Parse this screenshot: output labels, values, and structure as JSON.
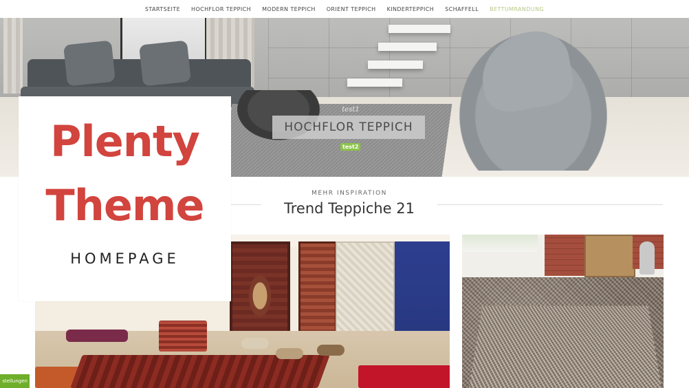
{
  "nav": {
    "items": [
      {
        "label": "STARTSEITE",
        "active": false
      },
      {
        "label": "HOCHFLOR TEPPICH",
        "active": false
      },
      {
        "label": "MODERN TEPPICH",
        "active": false
      },
      {
        "label": "ORIENT TEPPICH",
        "active": false
      },
      {
        "label": "KINDERTEPPICH",
        "active": false
      },
      {
        "label": "SCHAFFELL",
        "active": false
      },
      {
        "label": "BETTUMRANDUNG",
        "active": true
      }
    ]
  },
  "hero": {
    "subtitle": "test1",
    "title": "HOCHFLOR TEPPICH",
    "badge": "test2"
  },
  "overlay": {
    "line1": "Plenty",
    "line2": "Theme",
    "sub": "HOMEPAGE"
  },
  "section": {
    "kicker": "MEHR INSPIRATION",
    "title": "Trend Teppiche 21"
  },
  "settings_tab": {
    "label": "stellungen"
  },
  "colors": {
    "brand_red": "#d2443e",
    "accent_green": "#8bc34a",
    "nav_active": "#b6c98a",
    "tab_green": "#6fae2a"
  }
}
